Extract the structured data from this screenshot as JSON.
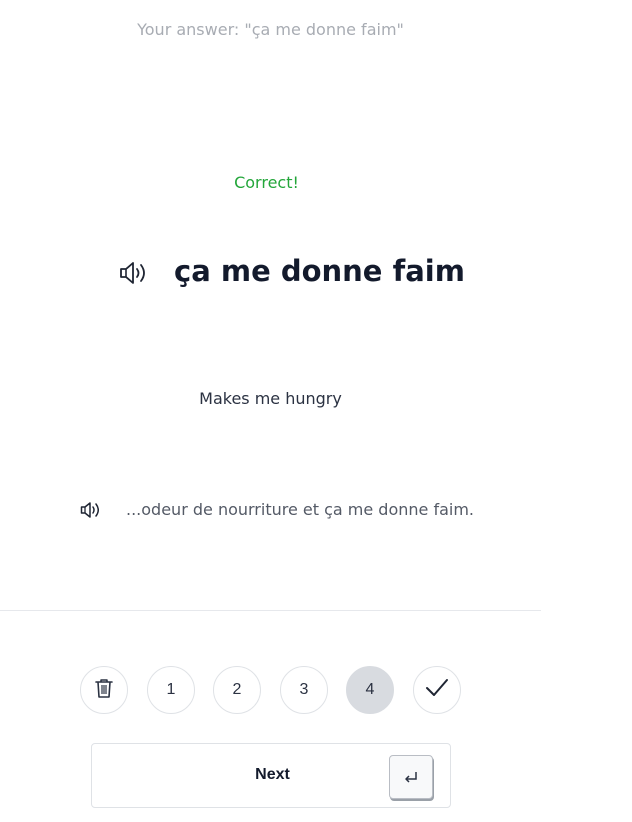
{
  "answer": {
    "your_answer_text": "Your answer: \"ça me donne faim\""
  },
  "feedback": {
    "status_text": "Correct!",
    "color": "#23a63a"
  },
  "phrase": {
    "text": "ça me donne faim",
    "audio_icon": "speaker-icon"
  },
  "translation": {
    "text": "Makes me hungry"
  },
  "example": {
    "text": "...odeur de nourriture et ça me donne faim.",
    "audio_icon": "speaker-icon"
  },
  "rating": {
    "delete_icon": "trash-icon",
    "options": [
      "1",
      "2",
      "3",
      "4"
    ],
    "selected": "4",
    "confirm_icon": "check-icon"
  },
  "next": {
    "label": "Next",
    "key_icon": "enter-key-icon"
  }
}
